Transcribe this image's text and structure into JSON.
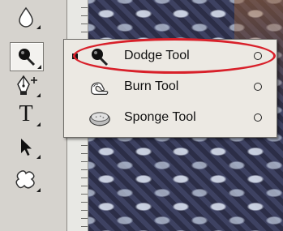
{
  "toolbar": {
    "tools": [
      {
        "name": "blur-tool",
        "icon": "drop-icon"
      },
      {
        "name": "dodge-tool",
        "icon": "dodge-icon",
        "active": true
      },
      {
        "name": "pen-tool",
        "icon": "pen-plus-icon"
      },
      {
        "name": "type-tool",
        "icon": "type-icon",
        "label": "T"
      },
      {
        "name": "path-selection-tool",
        "icon": "arrow-cursor-icon"
      },
      {
        "name": "custom-shape-tool",
        "icon": "shape-icon"
      }
    ]
  },
  "flyout": {
    "items": [
      {
        "label": "Dodge Tool",
        "icon": "dodge-icon",
        "selected": true
      },
      {
        "label": "Burn Tool",
        "icon": "burn-icon",
        "selected": false
      },
      {
        "label": "Sponge Tool",
        "icon": "sponge-icon",
        "selected": false
      }
    ]
  },
  "colors": {
    "annotation": "#d8202a",
    "toolbar_bg": "#d6d3ce",
    "menu_bg": "#ece9e3"
  }
}
